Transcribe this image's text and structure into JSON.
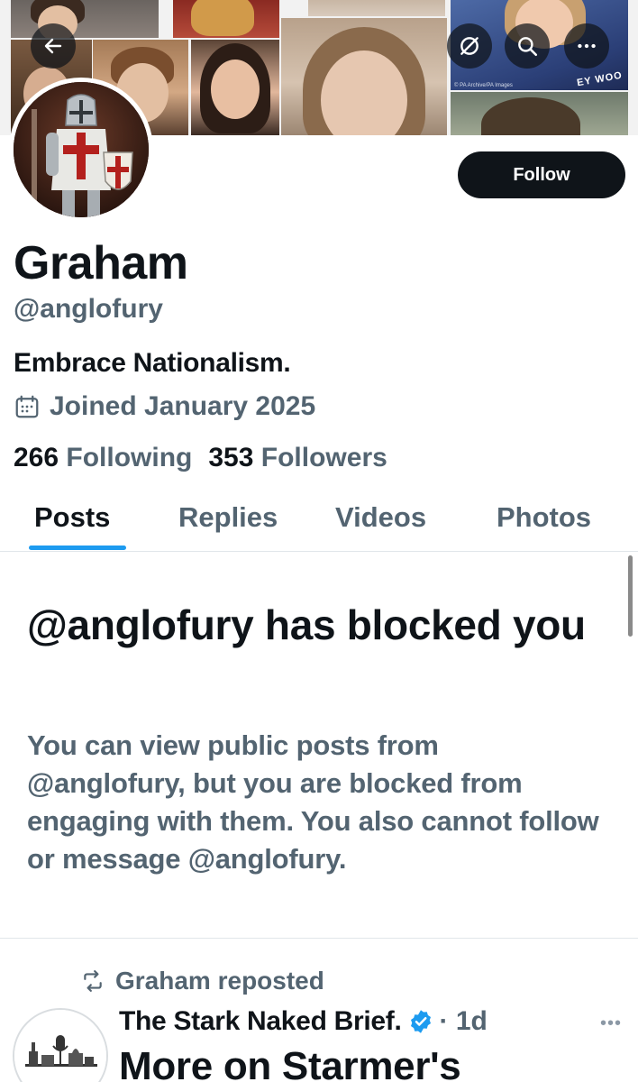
{
  "banner": {
    "caption": "© PA Archive/PA Images",
    "sign_text": "EY WOO"
  },
  "actions": {
    "follow_label": "Follow"
  },
  "profile": {
    "name": "Graham",
    "handle": "@anglofury",
    "bio": "Embrace Nationalism.",
    "joined": "Joined January 2025",
    "following_count": "266",
    "following_label": "Following",
    "followers_count": "353",
    "followers_label": "Followers"
  },
  "tabs": [
    {
      "label": "Posts",
      "active": true
    },
    {
      "label": "Replies",
      "active": false
    },
    {
      "label": "Videos",
      "active": false
    },
    {
      "label": "Photos",
      "active": false
    }
  ],
  "blocked": {
    "title": "@anglofury has blocked you",
    "body": "You can view public posts from @anglofury, but you are blocked from engaging with them. You also cannot follow or message @anglofury."
  },
  "post": {
    "repost_label": "Graham reposted",
    "author": "The Stark Naked Brief.",
    "time": "1d",
    "text": "More on Starmer's"
  },
  "colors": {
    "accent": "#1d9bf0",
    "text_primary": "#0f1419",
    "text_secondary": "#536471",
    "verified": "#1d9bf0"
  }
}
